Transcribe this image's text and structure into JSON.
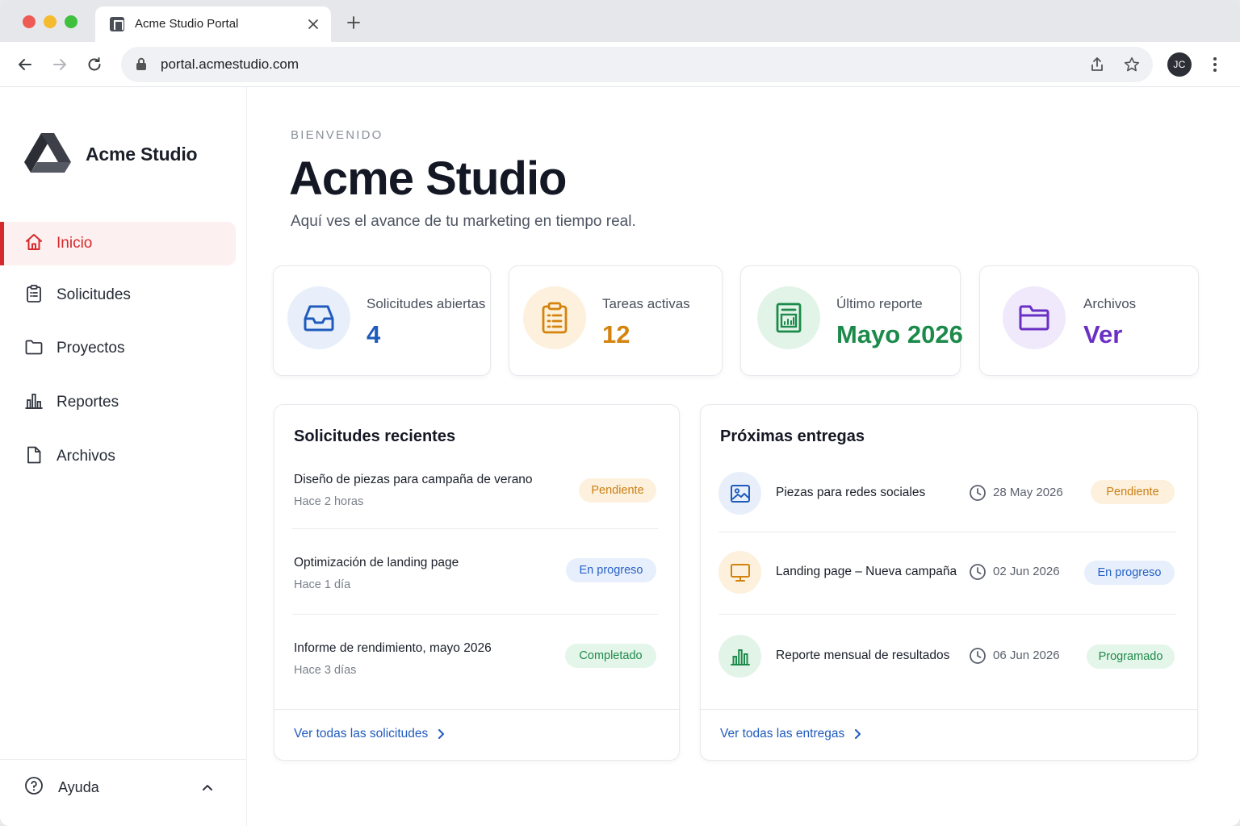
{
  "browser": {
    "tab_title": "Acme Studio Portal",
    "url": "portal.acmestudio.com",
    "avatar_initials": "JC"
  },
  "sidebar": {
    "brand": "Acme Studio",
    "items": [
      {
        "label": "Inicio",
        "icon": "home-icon",
        "active": true
      },
      {
        "label": "Solicitudes",
        "icon": "clipboard-icon",
        "active": false
      },
      {
        "label": "Proyectos",
        "icon": "folder-icon",
        "active": false
      },
      {
        "label": "Reportes",
        "icon": "bar-chart-icon",
        "active": false
      },
      {
        "label": "Archivos",
        "icon": "file-icon",
        "active": false
      }
    ],
    "help_label": "Ayuda"
  },
  "main": {
    "eyebrow": "BIENVENIDO",
    "title": "Acme Studio",
    "subtitle": "Aquí ves el avance de tu marketing en tiempo real."
  },
  "stats": [
    {
      "label": "Solicitudes abiertas",
      "value": "4",
      "icon": "inbox-icon",
      "color": "#1f5bbd",
      "bg": "#e8effa"
    },
    {
      "label": "Tareas activas",
      "value": "12",
      "icon": "clipboard-list-icon",
      "color": "#d4840e",
      "bg": "#fdf1dd"
    },
    {
      "label": "Último reporte",
      "value": "Mayo 2026",
      "icon": "report-icon",
      "color": "#1c8a4a",
      "bg": "#e2f4e8"
    },
    {
      "label": "Archivos",
      "value": "Ver",
      "icon": "folder-open-icon",
      "color": "#6a2fc4",
      "bg": "#efe9fb"
    }
  ],
  "requests": {
    "title": "Solicitudes recientes",
    "items": [
      {
        "title": "Diseño de piezas para campaña de verano",
        "time": "Hace 2 horas",
        "status": "Pendiente"
      },
      {
        "title": "Optimización de landing page",
        "time": "Hace 1 día",
        "status": "En progreso"
      },
      {
        "title": "Informe de rendimiento, mayo 2026",
        "time": "Hace 3 días",
        "status": "Completado"
      }
    ],
    "footer_link": "Ver todas las solicitudes"
  },
  "deliveries": {
    "title": "Próximas entregas",
    "items": [
      {
        "title": "Piezas para redes sociales",
        "date": "28 May 2026",
        "status": "Pendiente",
        "icon": "image-icon"
      },
      {
        "title": "Landing page – Nueva campaña",
        "date": "02 Jun 2026",
        "status": "En progreso",
        "icon": "monitor-icon"
      },
      {
        "title": "Reporte mensual de resultados",
        "date": "06 Jun 2026",
        "status": "Programado",
        "icon": "bar-chart-icon"
      }
    ],
    "footer_link": "Ver todas las entregas"
  }
}
